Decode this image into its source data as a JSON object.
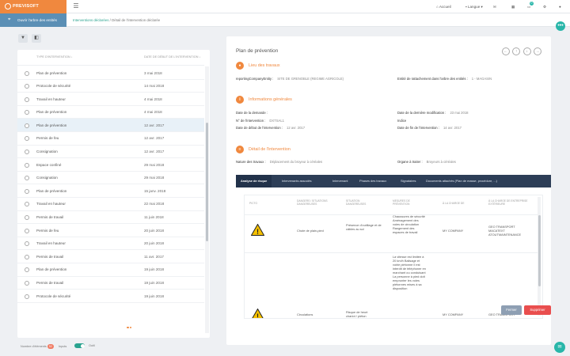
{
  "app": {
    "brand": "PREVISOFT"
  },
  "topbar": {
    "home": "Accueil",
    "language": "Langue",
    "badge_count": "0"
  },
  "subbar": {
    "pin_label": "Ouvrir l'arbre des entités",
    "breadcrumb_1": "Interventions déclarées",
    "breadcrumb_sep": "/",
    "breadcrumb_2": "Détail de l'intervention déclarée"
  },
  "list": {
    "col_type": "TYPE D'INTERVENTION ↓",
    "col_date": "DATE DE DÉBUT DE L'INTERVENTION ↓",
    "rows": [
      {
        "type": "Plan de prévention",
        "date": "3 mai 2018"
      },
      {
        "type": "Protocole de sécurité",
        "date": "14 mai 2018"
      },
      {
        "type": "Travail en hauteur",
        "date": "4 mai 2018"
      },
      {
        "type": "Plan de prévention",
        "date": "4 mai 2018"
      },
      {
        "type": "Plan de prévention",
        "date": "12 avr. 2017"
      },
      {
        "type": "Permis de feu",
        "date": "12 avr. 2017"
      },
      {
        "type": "Consignation",
        "date": "12 avr. 2017"
      },
      {
        "type": "Espace confiné",
        "date": "29 mai 2018"
      },
      {
        "type": "Consignation",
        "date": "29 mai 2018"
      },
      {
        "type": "Plan de prévention",
        "date": "15 janv. 2018"
      },
      {
        "type": "Travail en hauteur",
        "date": "22 mai 2018"
      },
      {
        "type": "Permis de travail",
        "date": "11 juin 2018"
      },
      {
        "type": "Permis de feu",
        "date": "20 juin 2018"
      },
      {
        "type": "Travail en hauteur",
        "date": "20 juin 2018"
      },
      {
        "type": "Permis de travail",
        "date": "11 avr. 2017"
      },
      {
        "type": "Plan de prévention",
        "date": "19 juin 2018"
      },
      {
        "type": "Permis de travail",
        "date": "19 juin 2018"
      },
      {
        "type": "Protocole de sécurité",
        "date": "19 juin 2018"
      }
    ],
    "selected_index": 4
  },
  "footer": {
    "count_label": "Nombre d'éléments",
    "count_value": "52",
    "inputs_label": "Inputs",
    "outputs_label": "Outil"
  },
  "detail": {
    "title": "Plan de prévention",
    "section_lieu": "Lieu des travaux",
    "reporting_label": "reportingCompanyEntity :",
    "reporting_value": "SITE DE GRENOBLE (REGIME AGRICOLE)",
    "entity_label": "Entité de rattachement dans l'arbre des entités :",
    "entity_value": "1 - MAGASIN",
    "section_info": "Informations générales",
    "date_demande_label": "Date de la demande :",
    "date_demande_value": "",
    "date_modif_label": "Date de la dernière modification :",
    "date_modif_value": "23 mai 2018",
    "num_label": "N° de l'intervention :",
    "num_value": "DXTSAL1",
    "indice_label": "Indice",
    "indice_value": "",
    "date_debut_label": "Date de début de l'intervention :",
    "date_debut_value": "12 avr. 2017",
    "date_fin_label": "Date de fin de l'intervention :",
    "date_fin_value": "14 avr. 2017",
    "section_detail": "Détail de l'intervention",
    "nature_label": "Nature des travaux :",
    "nature_value": "Déplacement du broyeur à céréales",
    "organe_label": "Organe à traiter :",
    "organe_value": "Broyeurs à céréales"
  },
  "tabs": [
    "Analyse de risque",
    "Intervenants associés",
    "Intervenant",
    "Phases des travaux",
    "Signataires",
    "Documents attachés (Plan de masse, procédure, ...)"
  ],
  "risk_table": {
    "headers": [
      "PICTO",
      "DANGERS / SITUATIONS DANGEREUSES",
      "SITUATION DANGEREUSES",
      "MESURES DE PRÉVENTION",
      "À LA CHARGE DE",
      "À LA CHARGE DE ENTREPRISE EXTÉRIEURE"
    ],
    "rows": [
      {
        "danger": "Chute de plain-pied",
        "situation": "Présence d'outillage et de câbles au sol",
        "mesures": "Chaussures de sécurité Aménagement des voies de circulation Rangement des espaces de travail",
        "charge": "MY COMPANY",
        "ext": "GEO TRANSPORT MACATEXT ATOUTMAINTENANCE"
      },
      {
        "danger": "Circulations",
        "situation": "Risque de heurt chariot / piéton",
        "mesures": "La vitesse est limitée à 20 km/h Balisage et voirie piétonne Il est interdit de téléphoner en marchant ou conduisant La personne à pied doit emprunter les voies piétonnes mises à sa disposition",
        "charge": "MY COMPANY",
        "ext": "GEO TRANSPORT"
      }
    ]
  },
  "buttons": {
    "close": "Fermer",
    "delete": "Supprimer"
  },
  "colors": {
    "brand": "#f0883e",
    "teal": "#29b6a9",
    "navy": "#2d3e57",
    "danger": "#e94e4e"
  }
}
